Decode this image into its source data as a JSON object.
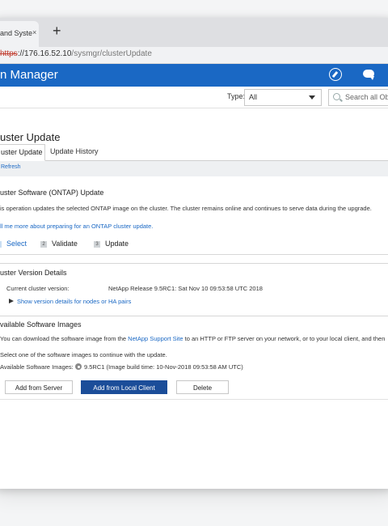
{
  "browser": {
    "tab_title": "and Syste",
    "tab_close": "×",
    "new_tab": "+",
    "url_scheme": "https",
    "url_host": "://176.16.52.10",
    "url_path": "/sysmgr/clusterUpdate"
  },
  "app": {
    "title": "n Manager",
    "icons": [
      "compass-icon",
      "chat-icon"
    ]
  },
  "filter": {
    "type_label": "Type:",
    "type_value": "All",
    "search_placeholder": "Search all Obj"
  },
  "page": {
    "title": "uster Update",
    "tabs": [
      {
        "label": "uster Update",
        "active": true
      },
      {
        "label": "Update History",
        "active": false
      }
    ],
    "refresh_label": "Refresh"
  },
  "software_update": {
    "heading": "uster Software (ONTAP) Update",
    "description": "is operation updates the selected ONTAP image on the cluster. The cluster remains online and continues to serve data during the upgrade.",
    "learn_more": "ll me more about preparing for an ONTAP cluster update."
  },
  "steps": [
    {
      "num": "1",
      "label": "Select",
      "active": true
    },
    {
      "num": "2",
      "label": "Validate",
      "active": false
    },
    {
      "num": "3",
      "label": "Update",
      "active": false
    }
  ],
  "version_details": {
    "heading": "uster Version Details",
    "current_label": "Current cluster version:",
    "current_value": "NetApp Release 9.5RC1: Sat Nov 10 09:53:58 UTC 2018",
    "show_details": "Show version details for nodes or HA pairs"
  },
  "software_images": {
    "heading": "vailable Software Images",
    "download_prefix": "You can download the software image from the ",
    "download_link": "NetApp Support Site",
    "download_suffix": " to an HTTP or FTP server on your network, or to your local client, and then",
    "select_text": "Select one of the software images to continue with the update.",
    "images_label": "Available Software Images:",
    "image_value": "9.5RC1 (Image build time: 10-Nov-2018 09:53:58 AM UTC)"
  },
  "buttons": {
    "add_from_server": "Add from Server",
    "add_from_local": "Add from Local Client",
    "delete": "Delete"
  },
  "colors": {
    "brand_blue": "#1a68c4",
    "primary_button": "#1b4d99"
  }
}
